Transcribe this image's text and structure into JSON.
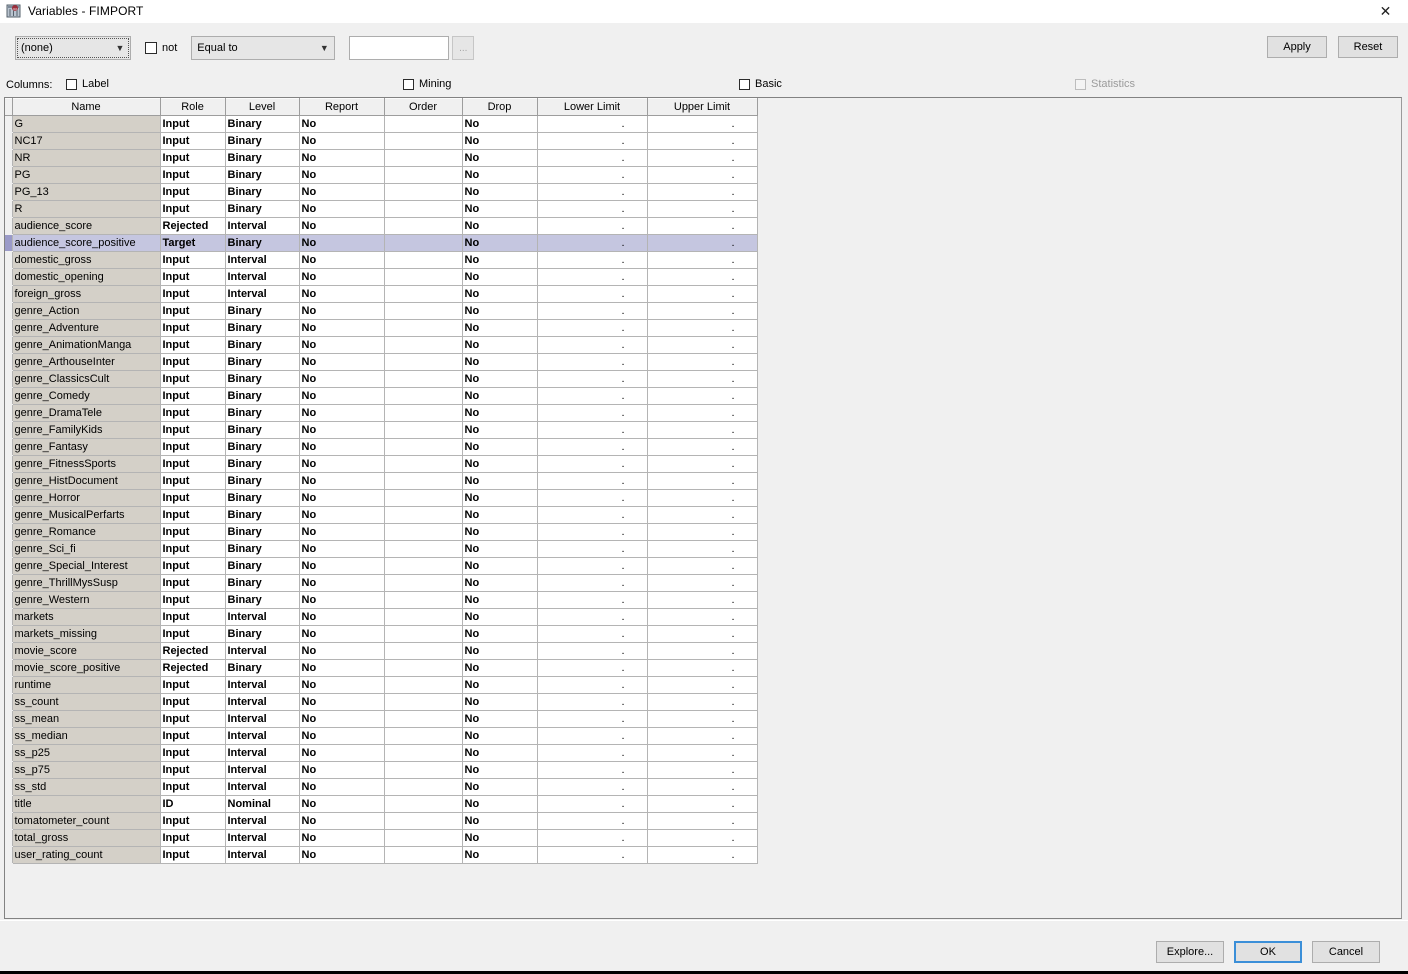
{
  "window": {
    "title": "Variables - FIMPORT",
    "icon": "sas-variables-icon",
    "close_label": "✕"
  },
  "filter": {
    "variable_select": {
      "value": "(none)",
      "icon": "chevron-down-icon"
    },
    "not_checkbox": {
      "label": "not",
      "checked": false
    },
    "operator_select": {
      "value": "Equal to",
      "icon": "chevron-down-icon"
    },
    "value_input": {
      "value": "",
      "placeholder": ""
    },
    "browse_button": {
      "label": "...",
      "disabled": true
    },
    "apply_button": "Apply",
    "reset_button": "Reset"
  },
  "columns_row": {
    "label": "Columns:",
    "checkboxes": [
      {
        "label": "Label",
        "checked": false,
        "disabled": false
      },
      {
        "label": "Mining",
        "checked": false,
        "disabled": false
      },
      {
        "label": "Basic",
        "checked": false,
        "disabled": false
      },
      {
        "label": "Statistics",
        "checked": false,
        "disabled": true
      }
    ]
  },
  "table": {
    "headers": [
      "Name",
      "Role",
      "Level",
      "Report",
      "Order",
      "Drop",
      "Lower Limit",
      "Upper Limit"
    ],
    "selected_row_index": 7,
    "rows": [
      [
        "G",
        "Input",
        "Binary",
        "No",
        "",
        "No",
        ".",
        "."
      ],
      [
        "NC17",
        "Input",
        "Binary",
        "No",
        "",
        "No",
        ".",
        "."
      ],
      [
        "NR",
        "Input",
        "Binary",
        "No",
        "",
        "No",
        ".",
        "."
      ],
      [
        "PG",
        "Input",
        "Binary",
        "No",
        "",
        "No",
        ".",
        "."
      ],
      [
        "PG_13",
        "Input",
        "Binary",
        "No",
        "",
        "No",
        ".",
        "."
      ],
      [
        "R",
        "Input",
        "Binary",
        "No",
        "",
        "No",
        ".",
        "."
      ],
      [
        "audience_score",
        "Rejected",
        "Interval",
        "No",
        "",
        "No",
        ".",
        "."
      ],
      [
        "audience_score_positive",
        "Target",
        "Binary",
        "No",
        "",
        "No",
        ".",
        "."
      ],
      [
        "domestic_gross",
        "Input",
        "Interval",
        "No",
        "",
        "No",
        ".",
        "."
      ],
      [
        "domestic_opening",
        "Input",
        "Interval",
        "No",
        "",
        "No",
        ".",
        "."
      ],
      [
        "foreign_gross",
        "Input",
        "Interval",
        "No",
        "",
        "No",
        ".",
        "."
      ],
      [
        "genre_Action",
        "Input",
        "Binary",
        "No",
        "",
        "No",
        ".",
        "."
      ],
      [
        "genre_Adventure",
        "Input",
        "Binary",
        "No",
        "",
        "No",
        ".",
        "."
      ],
      [
        "genre_AnimationManga",
        "Input",
        "Binary",
        "No",
        "",
        "No",
        ".",
        "."
      ],
      [
        "genre_ArthouseInter",
        "Input",
        "Binary",
        "No",
        "",
        "No",
        ".",
        "."
      ],
      [
        "genre_ClassicsCult",
        "Input",
        "Binary",
        "No",
        "",
        "No",
        ".",
        "."
      ],
      [
        "genre_Comedy",
        "Input",
        "Binary",
        "No",
        "",
        "No",
        ".",
        "."
      ],
      [
        "genre_DramaTele",
        "Input",
        "Binary",
        "No",
        "",
        "No",
        ".",
        "."
      ],
      [
        "genre_FamilyKids",
        "Input",
        "Binary",
        "No",
        "",
        "No",
        ".",
        "."
      ],
      [
        "genre_Fantasy",
        "Input",
        "Binary",
        "No",
        "",
        "No",
        ".",
        "."
      ],
      [
        "genre_FitnessSports",
        "Input",
        "Binary",
        "No",
        "",
        "No",
        ".",
        "."
      ],
      [
        "genre_HistDocument",
        "Input",
        "Binary",
        "No",
        "",
        "No",
        ".",
        "."
      ],
      [
        "genre_Horror",
        "Input",
        "Binary",
        "No",
        "",
        "No",
        ".",
        "."
      ],
      [
        "genre_MusicalPerfarts",
        "Input",
        "Binary",
        "No",
        "",
        "No",
        ".",
        "."
      ],
      [
        "genre_Romance",
        "Input",
        "Binary",
        "No",
        "",
        "No",
        ".",
        "."
      ],
      [
        "genre_Sci_fi",
        "Input",
        "Binary",
        "No",
        "",
        "No",
        ".",
        "."
      ],
      [
        "genre_Special_Interest",
        "Input",
        "Binary",
        "No",
        "",
        "No",
        ".",
        "."
      ],
      [
        "genre_ThrillMysSusp",
        "Input",
        "Binary",
        "No",
        "",
        "No",
        ".",
        "."
      ],
      [
        "genre_Western",
        "Input",
        "Binary",
        "No",
        "",
        "No",
        ".",
        "."
      ],
      [
        "markets",
        "Input",
        "Interval",
        "No",
        "",
        "No",
        ".",
        "."
      ],
      [
        "markets_missing",
        "Input",
        "Binary",
        "No",
        "",
        "No",
        ".",
        "."
      ],
      [
        "movie_score",
        "Rejected",
        "Interval",
        "No",
        "",
        "No",
        ".",
        "."
      ],
      [
        "movie_score_positive",
        "Rejected",
        "Binary",
        "No",
        "",
        "No",
        ".",
        "."
      ],
      [
        "runtime",
        "Input",
        "Interval",
        "No",
        "",
        "No",
        ".",
        "."
      ],
      [
        "ss_count",
        "Input",
        "Interval",
        "No",
        "",
        "No",
        ".",
        "."
      ],
      [
        "ss_mean",
        "Input",
        "Interval",
        "No",
        "",
        "No",
        ".",
        "."
      ],
      [
        "ss_median",
        "Input",
        "Interval",
        "No",
        "",
        "No",
        ".",
        "."
      ],
      [
        "ss_p25",
        "Input",
        "Interval",
        "No",
        "",
        "No",
        ".",
        "."
      ],
      [
        "ss_p75",
        "Input",
        "Interval",
        "No",
        "",
        "No",
        ".",
        "."
      ],
      [
        "ss_std",
        "Input",
        "Interval",
        "No",
        "",
        "No",
        ".",
        "."
      ],
      [
        "title",
        "ID",
        "Nominal",
        "No",
        "",
        "No",
        ".",
        "."
      ],
      [
        "tomatometer_count",
        "Input",
        "Interval",
        "No",
        "",
        "No",
        ".",
        "."
      ],
      [
        "total_gross",
        "Input",
        "Interval",
        "No",
        "",
        "No",
        ".",
        "."
      ],
      [
        "user_rating_count",
        "Input",
        "Interval",
        "No",
        "",
        "No",
        ".",
        "."
      ]
    ]
  },
  "footer": {
    "explore_button": "Explore...",
    "ok_button": "OK",
    "cancel_button": "Cancel"
  },
  "colors": {
    "selection": "#c5c6e0",
    "name_column": "#d4d0c8",
    "dialog_bg": "#f0f0f0",
    "focus_blue": "#3b8fd8"
  }
}
